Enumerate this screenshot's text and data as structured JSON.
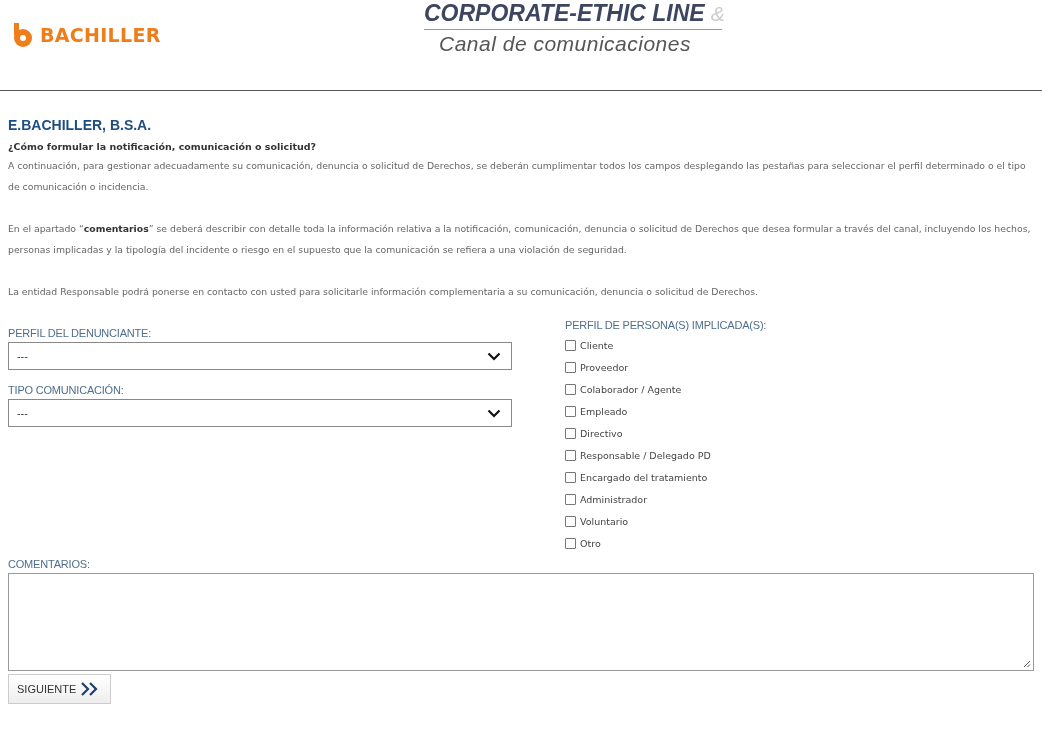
{
  "header": {
    "brand": "BACHILLER",
    "title": "CORPORATE-ETHIC LINE",
    "title_suffix": "&",
    "subtitle": "Canal de comunicaciones"
  },
  "company": "E.BACHILLER, B.S.A.",
  "intro": {
    "heading": "¿Cómo formular la notificación, comunicación o solicitud?",
    "paragraphs": [
      "A continuación, para gestionar adecuadamente su comunicación, denuncia o solicitud de Derechos, se deberán cumplimentar todos los campos desplegando las pestañas para seleccionar el perfil determinado o el tipo de comunicación o incidencia.",
      "En el apartado “**comentarios**” se deberá describir con detalle toda la información relativa a la notificación, comunicación, denuncia o solicitud de Derechos que desea formular a través del canal, incluyendo los hechos, personas implicadas y la tipología del incidente o riesgo en el supuesto que la comunicación se refiera a una violación de seguridad.",
      "La entidad Responsable podrá ponerse en contacto con usted para solicitarle información complementaria a su comunicación, denuncia o solicitud de Derechos."
    ]
  },
  "selects": [
    {
      "label": "PERFIL DEL DENUNCIANTE:",
      "value": "---"
    },
    {
      "label": "TIPO COMUNICACIÓN:",
      "value": "---"
    }
  ],
  "persons": {
    "label": "PERFIL DE PERSONA(S) IMPLICADA(S):",
    "options": [
      {
        "label": "Cliente",
        "checked": false
      },
      {
        "label": "Proveedor",
        "checked": false
      },
      {
        "label": "Colaborador / Agente",
        "checked": false
      },
      {
        "label": "Empleado",
        "checked": false
      },
      {
        "label": "Directivo",
        "checked": false
      },
      {
        "label": "Responsable / Delegado PD",
        "checked": false
      },
      {
        "label": "Encargado del tratamiento",
        "checked": false
      },
      {
        "label": "Administrador",
        "checked": false
      },
      {
        "label": "Voluntario",
        "checked": false
      },
      {
        "label": "Otro",
        "checked": false
      }
    ]
  },
  "comments": {
    "label": "COMENTARIOS:"
  },
  "next_button": {
    "label": "SIGUIENTE"
  }
}
